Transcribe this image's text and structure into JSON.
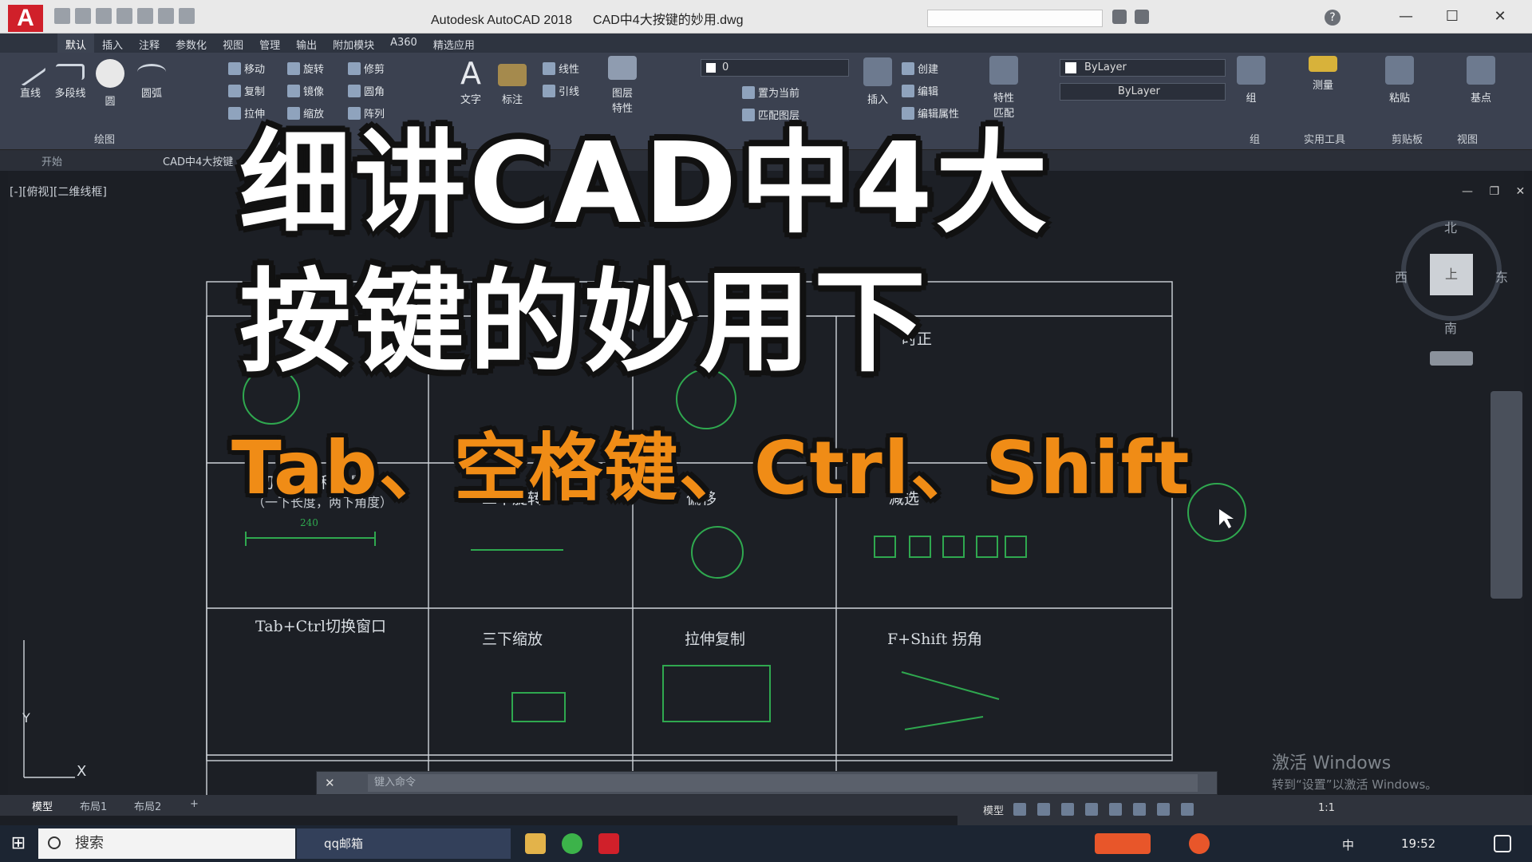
{
  "window": {
    "app_logo": "A",
    "title": "Autodesk AutoCAD 2018",
    "file": "CAD中4大按键的妙用.dwg",
    "minimize": "—",
    "maximize": "☐",
    "close": "✕",
    "help": "?"
  },
  "ribbon_tabs": [
    "默认",
    "插入",
    "注释",
    "参数化",
    "视图",
    "管理",
    "输出",
    "附加模块",
    "A360",
    "精选应用"
  ],
  "ribbon": {
    "draw": {
      "line": "直线",
      "polyline": "多段线",
      "circle": "圆",
      "arc": "圆弧",
      "panel": "绘图"
    },
    "modify": {
      "move": "移动",
      "rotate": "旋转",
      "trim": "修剪",
      "copy": "复制",
      "mirror": "镜像",
      "fillet": "圆角",
      "stretch": "拉伸",
      "scale": "缩放",
      "array": "阵列"
    },
    "annotation": {
      "text": "文字",
      "dimension": "标注",
      "linear": "线性",
      "leader": "引线"
    },
    "layers": {
      "properties": "图层",
      "properties2": "特性",
      "current_layer": "0",
      "set_current": "置为当前",
      "match_layer": "匹配图层"
    },
    "block": {
      "insert": "插入",
      "create": "创建",
      "edit": "编辑",
      "edit_attr": "编辑属性"
    },
    "properties": {
      "label": "特性",
      "match": "匹配",
      "color": "ByLayer",
      "linetype": "ByLayer"
    },
    "groups": {
      "group": "组",
      "panel": "组"
    },
    "utilities": {
      "measure": "测量",
      "panel": "实用工具"
    },
    "clipboard": {
      "paste": "粘贴",
      "panel": "剪贴板"
    },
    "view": {
      "base": "基点",
      "panel": "视图"
    }
  },
  "doc_tabs": {
    "start": "开始",
    "active": "CAD中4大按键"
  },
  "viewport": {
    "label": "[-][俯视][二维线框]",
    "controls": "— ❐ ✕"
  },
  "table_cells": {
    "c5": "时正",
    "r2c1_title": "切换增量和总量",
    "r2c1_sub": "（一下长度，两下角度）",
    "r2c1_dim": "240",
    "r2c2": "二下旋转",
    "r2c3": "偏移",
    "r2c4": "减选",
    "r3c1": "Tab+Ctrl切换窗口",
    "r3c2": "三下缩放",
    "r3c3": "拉伸复制",
    "r3c4": "F+Shift 拐角"
  },
  "viewcube": {
    "north": "北",
    "south": "南",
    "west": "西",
    "east": "东",
    "top": "上"
  },
  "ucs": {
    "y": "Y",
    "x": "X"
  },
  "command_line": {
    "close": "✕",
    "placeholder": "键入命令"
  },
  "layout_tabs": [
    "模型",
    "布局1",
    "布局2",
    "+"
  ],
  "status": {
    "model": "模型",
    "scale": "1:1"
  },
  "watermark": {
    "line1": "激活 Windows",
    "line2": "转到“设置”以激活 Windows。"
  },
  "taskbar": {
    "search": "搜索",
    "app": "qq邮箱",
    "ime": "中",
    "time": "19:52"
  },
  "overlay": {
    "line1": "细讲CAD中4大",
    "line2": "按键的妙用下",
    "sub": "Tab、空格键、Ctrl、Shift"
  },
  "colors": {
    "accent_orange": "#f08c16",
    "cad_green": "#2fa84f",
    "autodesk_red": "#d0202a"
  }
}
